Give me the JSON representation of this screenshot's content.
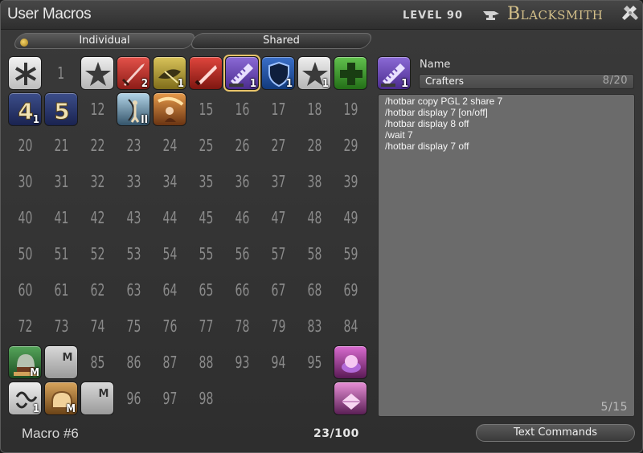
{
  "window": {
    "title": "User Macros",
    "level_label": "LEVEL 90",
    "job_name": "Blacksmith",
    "close_icon": "crossed-tools-icon"
  },
  "tabs": [
    {
      "label": "Individual",
      "active": true
    },
    {
      "label": "Shared",
      "active": false
    }
  ],
  "grid": {
    "numbers": [
      "1",
      "12",
      "15",
      "16",
      "17",
      "18",
      "19",
      "20",
      "21",
      "22",
      "23",
      "24",
      "25",
      "26",
      "27",
      "28",
      "29",
      "30",
      "31",
      "32",
      "33",
      "34",
      "35",
      "36",
      "37",
      "38",
      "39",
      "40",
      "41",
      "42",
      "43",
      "44",
      "45",
      "46",
      "47",
      "48",
      "49",
      "50",
      "51",
      "52",
      "53",
      "54",
      "55",
      "56",
      "57",
      "58",
      "59",
      "60",
      "61",
      "62",
      "63",
      "64",
      "65",
      "66",
      "67",
      "68",
      "69",
      "72",
      "73",
      "74",
      "75",
      "76",
      "77",
      "78",
      "79",
      "83",
      "84",
      "85",
      "86",
      "87",
      "88",
      "93",
      "94",
      "95",
      "96",
      "97",
      "98"
    ],
    "slot_badges": {
      "slot_3": "2",
      "slot_4": "1",
      "slot_6": "1",
      "slot_7": "1",
      "slot_8": "1",
      "slot_10": "1",
      "slot_13": "II",
      "slot_90": "1",
      "slot_80": "M",
      "slot_91": "M",
      "slot_92": "M"
    },
    "slot_text": {
      "slot_10": "4",
      "slot_11": "5"
    },
    "icons": {
      "slot_0": "asterisk-icon",
      "slot_2": "star-icon",
      "slot_3": "red-sword-icon",
      "slot_4": "gold-fish-icon",
      "slot_5": "red-blade-icon",
      "slot_6": "purple-saw-icon",
      "slot_7": "blue-shield-icon",
      "slot_8": "star-icon",
      "slot_9": "green-cross-icon",
      "slot_10": "number-four-icon",
      "slot_11": "number-five-icon",
      "slot_13": "archer-icon",
      "slot_14": "mage-icon",
      "slot_80": "green-helmet-icon",
      "slot_81": "macro-m-icon",
      "slot_89": "pink-orb-icon",
      "slot_90": "squiggle-icon",
      "slot_91": "bread-icon",
      "slot_92": "macro-m-icon",
      "slot_99": "pink-crystal-icon",
      "slot_100": "yellow-saw-icon",
      "slot_101": "purple-ring-icon",
      "slot_102": "macro-m-icon"
    }
  },
  "selected_slot": 6,
  "editor": {
    "preview_icon": "purple-saw-icon",
    "preview_badge": "1",
    "name_label": "Name",
    "name_value": "Crafters",
    "name_count": "8/20",
    "lines": [
      "/hotbar copy PGL 2 share 7",
      "/hotbar display 7 [on/off]",
      "/hotbar display 8 off",
      "/wait 7",
      "/hotbar display 7 off"
    ],
    "line_count": "5/15"
  },
  "footer": {
    "macro_label": "Macro #6",
    "used_count": "23/100",
    "text_commands_label": "Text Commands"
  },
  "colors": {
    "accent_gold": "#d4c08a",
    "background": "#333333",
    "text_area": "#6b6b6b"
  }
}
